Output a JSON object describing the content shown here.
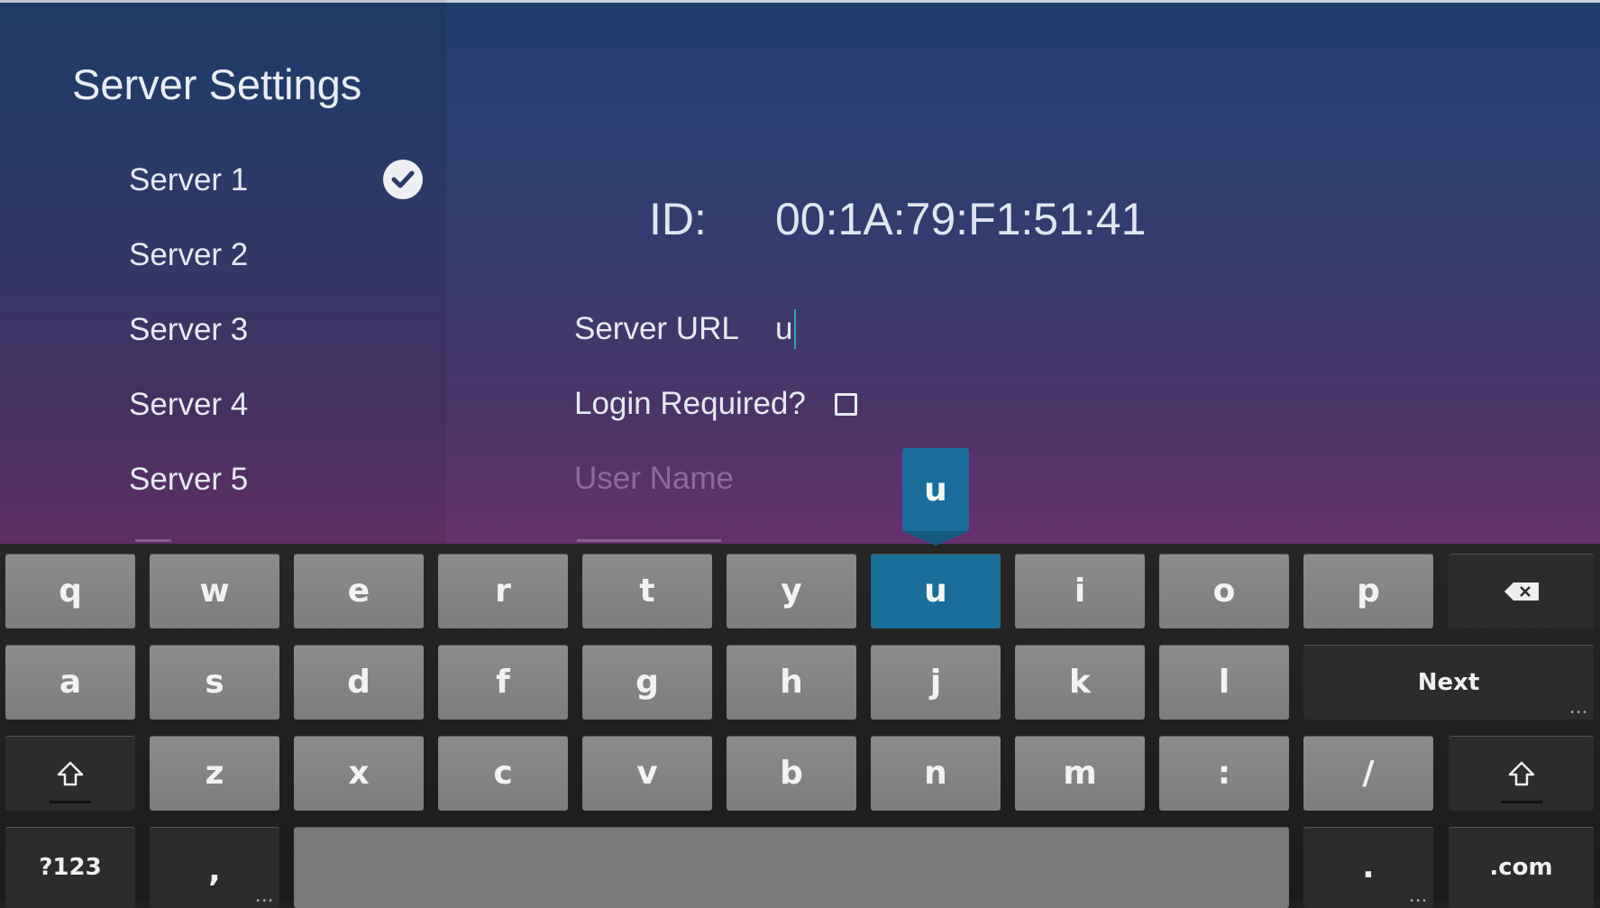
{
  "page": {
    "title": "Server Settings"
  },
  "servers": [
    {
      "label": "Server 1",
      "selected": true
    },
    {
      "label": "Server 2",
      "selected": false
    },
    {
      "label": "Server 3",
      "selected": false
    },
    {
      "label": "Server 4",
      "selected": false
    },
    {
      "label": "Server 5",
      "selected": false
    }
  ],
  "details": {
    "id_label": "ID:",
    "id_value": "00:1A:79:F1:51:41",
    "server_url_label": "Server URL",
    "server_url_value": "u",
    "login_required_label": "Login Required?",
    "login_required_checked": false,
    "username_placeholder": "User Name"
  },
  "keyboard": {
    "popup_char": "u",
    "accent_color": "#1a6e9a",
    "rows": [
      [
        "q",
        "w",
        "e",
        "r",
        "t",
        "y",
        "u",
        "i",
        "o",
        "p"
      ],
      [
        "a",
        "s",
        "d",
        "f",
        "g",
        "h",
        "j",
        "k",
        "l"
      ],
      [
        "z",
        "x",
        "c",
        "v",
        "b",
        "n",
        "m",
        ":",
        "/"
      ]
    ],
    "active_key": "u",
    "next_label": "Next",
    "symbols_label": "?123",
    "comma_label": ",",
    "period_label": ".",
    "dotcom_label": ".com",
    "icons": {
      "backspace": "backspace-icon",
      "shift": "shift-icon",
      "check": "check-circle-icon"
    }
  }
}
